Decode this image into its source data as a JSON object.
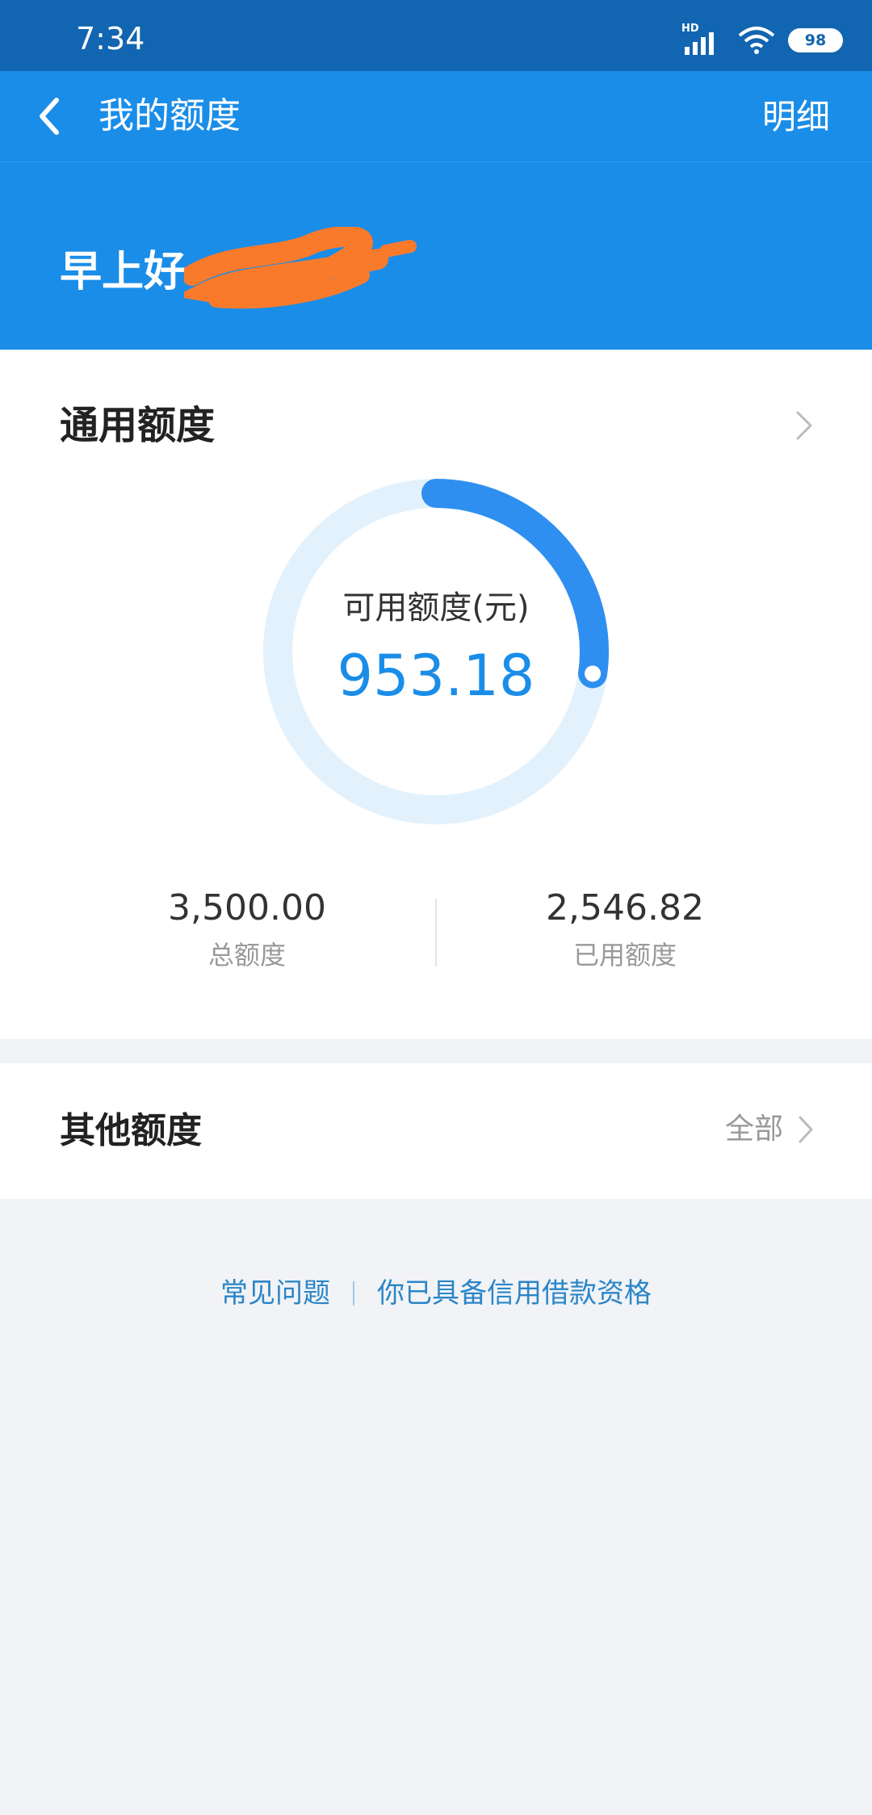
{
  "status_bar": {
    "time": "7:34",
    "signal_label": "HD",
    "battery": "98",
    "icons": [
      "signal-icon",
      "wifi-icon",
      "battery-icon"
    ]
  },
  "nav": {
    "back_icon": "chevron-left-icon",
    "title": "我的额度",
    "detail_label": "明细"
  },
  "greeting": {
    "text": "早上好"
  },
  "general_quota": {
    "title": "通用额度",
    "available_label": "可用额度(元)",
    "available_value": "953.18",
    "available_fraction": 0.2723,
    "total_value": "3,500.00",
    "total_label": "总额度",
    "used_value": "2,546.82",
    "used_label": "已用额度"
  },
  "other_quota": {
    "title": "其他额度",
    "all_label": "全部"
  },
  "footer": {
    "faq": "常见问题",
    "eligibility": "你已具备信用借款资格"
  },
  "colors": {
    "status_bar": "#1265b0",
    "header_blue": "#1a8de8",
    "ring_track": "#e2f1fc",
    "ring_progress": "#2f8ff0",
    "value_blue": "#1a8de8",
    "footer_link": "#2b86c8",
    "page_bg": "#f2f3f6",
    "redaction": "#f97a2b"
  }
}
